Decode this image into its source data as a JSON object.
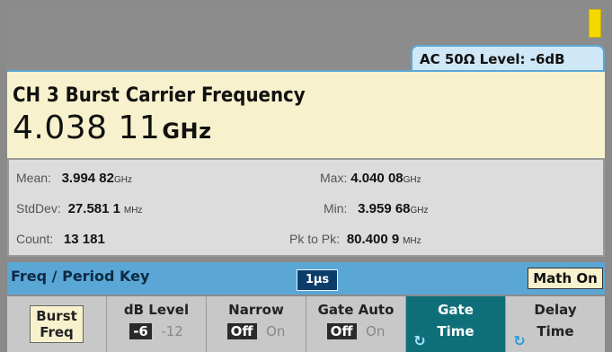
{
  "status": {
    "coupling": "AC 50Ω  Level: -6dB",
    "battery_icon": "battery-icon"
  },
  "measurement": {
    "title": "CH 3 Burst Carrier Frequency",
    "value": "4.038 11",
    "unit": "GHz"
  },
  "stats": {
    "mean": {
      "label": "Mean:",
      "value": "3.994 82",
      "unit": "GHz"
    },
    "max": {
      "label": "Max:",
      "value": "4.040 08",
      "unit": "GHz"
    },
    "stddev": {
      "label": "StdDev:",
      "value": "27.581 1",
      "unit": "MHz"
    },
    "min": {
      "label": "Min:",
      "value": "3.959 68",
      "unit": "GHz"
    },
    "count": {
      "label": "Count:",
      "value": "13 181"
    },
    "pk2pk": {
      "label": "Pk to Pk:",
      "value": "80.400 9",
      "unit": "MHz"
    }
  },
  "key_bar": {
    "label": "Freq / Period Key",
    "gate_chip": "1μs",
    "math_button": "Math On"
  },
  "softkeys": {
    "burst": {
      "top": "Burst",
      "bottom": "Freq"
    },
    "dblevel": {
      "top": "dB Level",
      "on": "-6",
      "off": "-12"
    },
    "narrow": {
      "top": "Narrow",
      "on": "Off",
      "off": "On"
    },
    "gateauto": {
      "top": "Gate Auto",
      "on": "Off",
      "off": "On"
    },
    "gatetime": {
      "top": "Gate",
      "bottom": "Time",
      "icon": "knob-icon"
    },
    "delaytime": {
      "top": "Delay",
      "bottom": "Time",
      "icon": "knob-icon"
    }
  },
  "colors": {
    "accent_blue": "#5aa7d6",
    "panel_yellow": "#f7f2cd",
    "softkey_selected": "#0f6f78",
    "battery_yellow": "#f4d800"
  }
}
